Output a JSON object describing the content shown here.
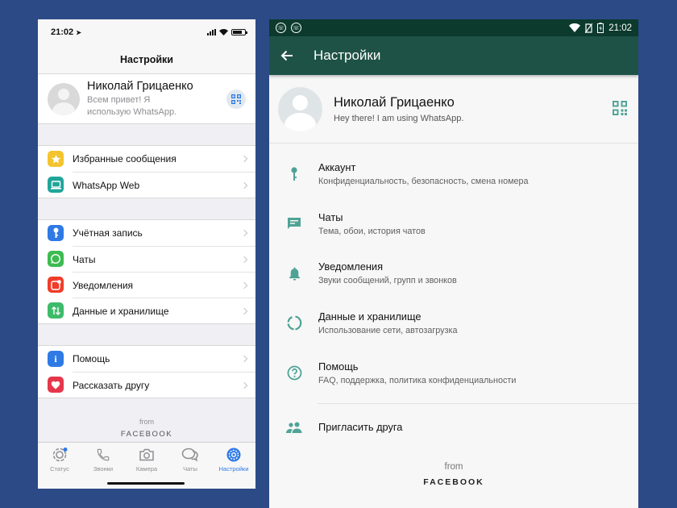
{
  "ios": {
    "status": {
      "time": "21:02"
    },
    "title": "Настройки",
    "profile": {
      "name": "Николай Грицаенко",
      "status": "Всем привет! Я использую WhatsApp."
    },
    "groups": [
      [
        {
          "label": "Избранные сообщения",
          "icon": "star-icon",
          "color": "#f4c430"
        },
        {
          "label": "WhatsApp Web",
          "icon": "laptop-icon",
          "color": "#21a59a"
        }
      ],
      [
        {
          "label": "Учётная запись",
          "icon": "key-icon",
          "color": "#2f7ae5"
        },
        {
          "label": "Чаты",
          "icon": "whatsapp-icon",
          "color": "#3dbb51"
        },
        {
          "label": "Уведомления",
          "icon": "notification-icon",
          "color": "#ef3c2b"
        },
        {
          "label": "Данные и хранилище",
          "icon": "data-arrows-icon",
          "color": "#3dbb6a"
        }
      ],
      [
        {
          "label": "Помощь",
          "icon": "info-icon",
          "color": "#2f7ae5"
        },
        {
          "label": "Рассказать другу",
          "icon": "heart-icon",
          "color": "#e5374b"
        }
      ]
    ],
    "footer": {
      "from": "from",
      "brand": "FACEBOOK"
    },
    "tabs": [
      {
        "label": "Статус",
        "icon": "status-icon"
      },
      {
        "label": "Звонки",
        "icon": "phone-icon"
      },
      {
        "label": "Камера",
        "icon": "camera-icon"
      },
      {
        "label": "Чаты",
        "icon": "chats-icon"
      },
      {
        "label": "Настройки",
        "icon": "settings-gear-icon",
        "active": true
      }
    ]
  },
  "android": {
    "status": {
      "time": "21:02"
    },
    "title": "Настройки",
    "profile": {
      "name": "Николай Грицаенко",
      "status": "Hey there! I am using WhatsApp."
    },
    "items": [
      {
        "label": "Аккаунт",
        "sub": "Конфиденциальность, безопасность, смена номера",
        "icon": "key-icon"
      },
      {
        "label": "Чаты",
        "sub": "Тема, обои, история чатов",
        "icon": "chat-icon"
      },
      {
        "label": "Уведомления",
        "sub": "Звуки сообщений, групп и звонков",
        "icon": "bell-icon"
      },
      {
        "label": "Данные и хранилище",
        "sub": "Использование сети, автозагрузка",
        "icon": "data-usage-icon"
      },
      {
        "label": "Помощь",
        "sub": "FAQ, поддержка, политика конфиденциальности",
        "icon": "help-icon"
      }
    ],
    "invite": {
      "label": "Пригласить друга",
      "icon": "people-icon"
    },
    "footer": {
      "from": "from",
      "brand": "FACEBOOK"
    },
    "accent": "#1f5247",
    "icon_color": "#4fa396"
  }
}
